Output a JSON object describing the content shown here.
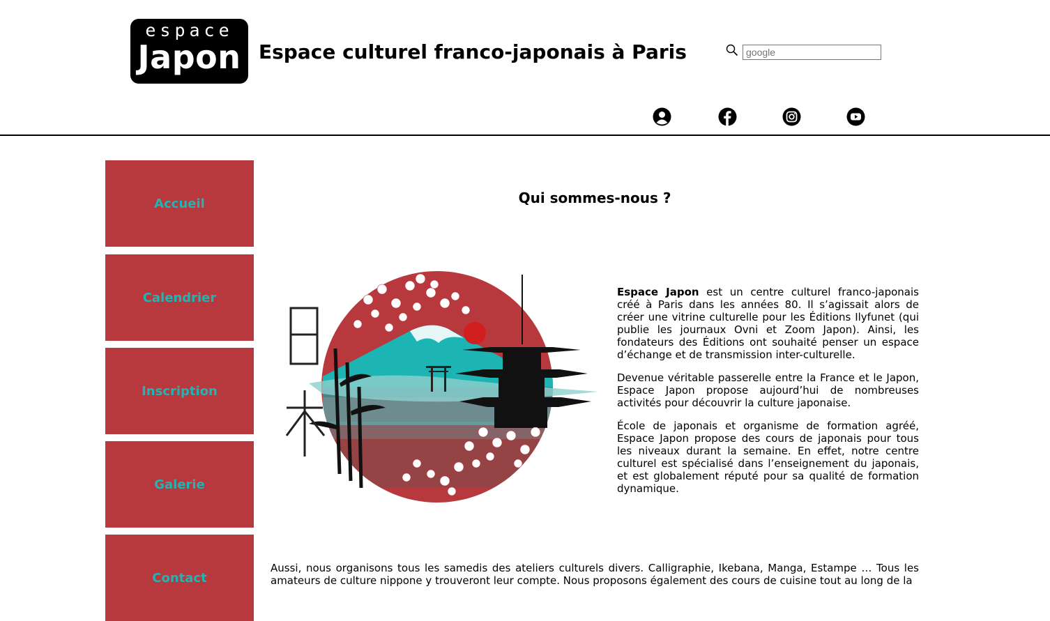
{
  "logo": {
    "top": "espace",
    "main": "Japon"
  },
  "site_title": "Espace culturel franco-japonais à Paris",
  "search": {
    "placeholder": "google",
    "icon": "search-icon"
  },
  "social_icons": [
    "user-icon",
    "facebook-icon",
    "instagram-icon",
    "youtube-icon"
  ],
  "nav": {
    "items": [
      {
        "label": "Accueil"
      },
      {
        "label": "Calendrier"
      },
      {
        "label": "Inscription"
      },
      {
        "label": "Galerie"
      },
      {
        "label": "Contact"
      }
    ]
  },
  "main": {
    "title": "Qui sommes-nous ?",
    "intro_bold": "Espace Japon",
    "intro_p1": " est un centre culturel franco-japonais créé à Paris dans les années 80. Il s’agissait alors de créer une vitrine culturelle pour les Éditions Ilyfunet (qui publie les journaux Ovni et Zoom Japon). Ainsi, les fondateurs des Éditions ont souhaité penser un espace d’échange et de transmission inter-culturelle.",
    "intro_p2": "Devenue véritable passerelle entre la France et le Japon, Espace Japon propose aujourd’hui de nombreuses activités pour découvrir la culture japonaise.",
    "intro_p3": "École de japonais et organisme de formation agréé, Espace Japon propose des cours de japonais pour tous les niveaux durant la semaine. En effet, notre centre culturel est spécialisé dans l’enseignement du japonais, et est globalement réputé pour sa qualité de formation dynamique.",
    "bottom": "Aussi, nous organisons tous les samedis des ateliers culturels divers. Calligraphie, Ikebana, Manga, Estampe … Tous les amateurs de culture nippone y trouveront leur compte. Nous proposons également des cours de cuisine tout au long de la"
  },
  "colors": {
    "nav_bg": "#b8393d",
    "nav_text": "#23b3b3",
    "sun_red": "#b8393d"
  }
}
